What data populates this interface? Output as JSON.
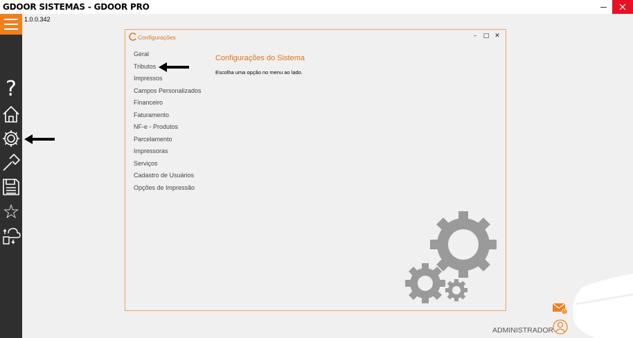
{
  "window": {
    "title": "GDOOR SISTEMAS - GDOOR PRO",
    "version": "1.0.0.342",
    "close_color": "#e81123"
  },
  "sidebar": {
    "accent": "#f07f1e",
    "background": "#2f2f2f",
    "items": [
      {
        "icon": "menu-icon"
      },
      {
        "icon": "help-icon",
        "glyph": "?"
      },
      {
        "icon": "home-icon"
      },
      {
        "icon": "gear-icon"
      },
      {
        "icon": "tools-icon"
      },
      {
        "icon": "save-icon"
      },
      {
        "icon": "star-icon",
        "glyph": "☆"
      },
      {
        "icon": "cloud-sync-icon"
      }
    ]
  },
  "dialog": {
    "title": "Configurações",
    "buttons": {
      "minimize": "–",
      "maximize": "□",
      "close": "✕"
    },
    "menu": [
      "Geral",
      "Tributos",
      "Impressos",
      "Campos Personalizados",
      "Financeiro",
      "Faturamento",
      "NF-e - Produtos",
      "Parcelamento",
      "Impressoras",
      "Serviços",
      "Cadastro de Usuários",
      "Opções de Impressão"
    ],
    "content_title": "Configurações do Sistema",
    "content_subtitle": "Escolha uma opção no menu ao lado."
  },
  "footer": {
    "user_label": "ADMINISTRADOR",
    "mail_badge": "0"
  }
}
